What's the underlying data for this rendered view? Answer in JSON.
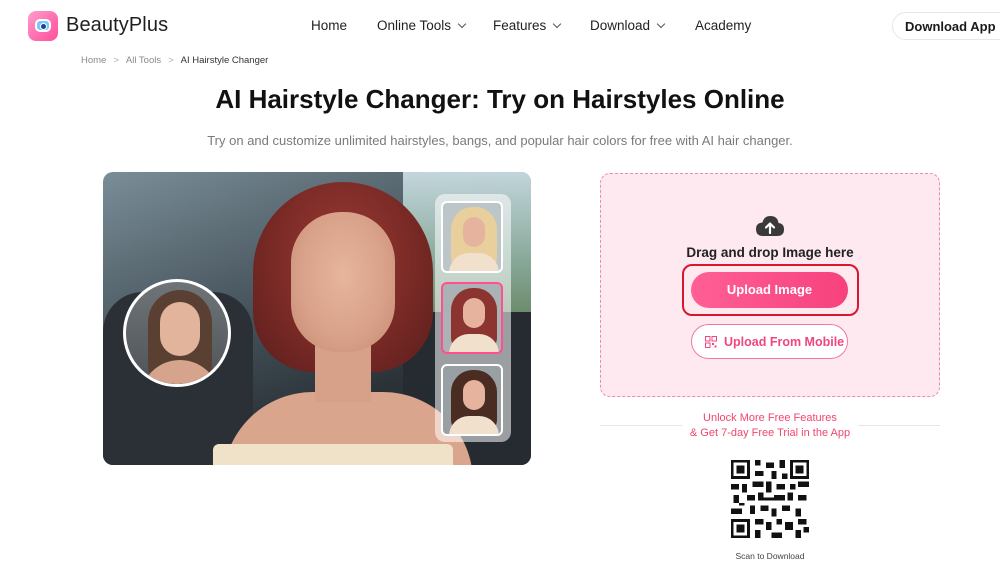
{
  "brand": {
    "name": "BeautyPlus"
  },
  "nav": {
    "items": [
      {
        "label": "Home",
        "dropdown": false
      },
      {
        "label": "Online Tools",
        "dropdown": true
      },
      {
        "label": "Features",
        "dropdown": true
      },
      {
        "label": "Download",
        "dropdown": true
      },
      {
        "label": "Academy",
        "dropdown": false
      }
    ],
    "cta": "Download App"
  },
  "breadcrumb": {
    "items": [
      "Home",
      "All Tools",
      "AI Hairstyle Changer"
    ]
  },
  "page": {
    "title": "AI Hairstyle Changer: Try on Hairstyles Online",
    "subtitle": "Try on and customize unlimited hairstyles, bangs, and popular hair colors for free with AI hair changer."
  },
  "hero": {
    "thumbnails": [
      {
        "style": "blonde",
        "selected": false
      },
      {
        "style": "auburn bob",
        "selected": true
      },
      {
        "style": "brunette waves",
        "selected": false
      }
    ]
  },
  "upload": {
    "icon": "cloud-upload-icon",
    "drag_text": "Drag and drop Image here",
    "upload_label": "Upload Image",
    "mobile_label": "Upload From Mobile"
  },
  "promo": {
    "line1": "Unlock More Free Features",
    "line2": "& Get 7-day Free Trial in the App",
    "scan_text": "Scan to Download"
  },
  "colors": {
    "accent": "#f7417d",
    "panel_bg": "#fde9ef",
    "panel_border": "#f08aa8",
    "highlight_ring": "#d9152f"
  }
}
